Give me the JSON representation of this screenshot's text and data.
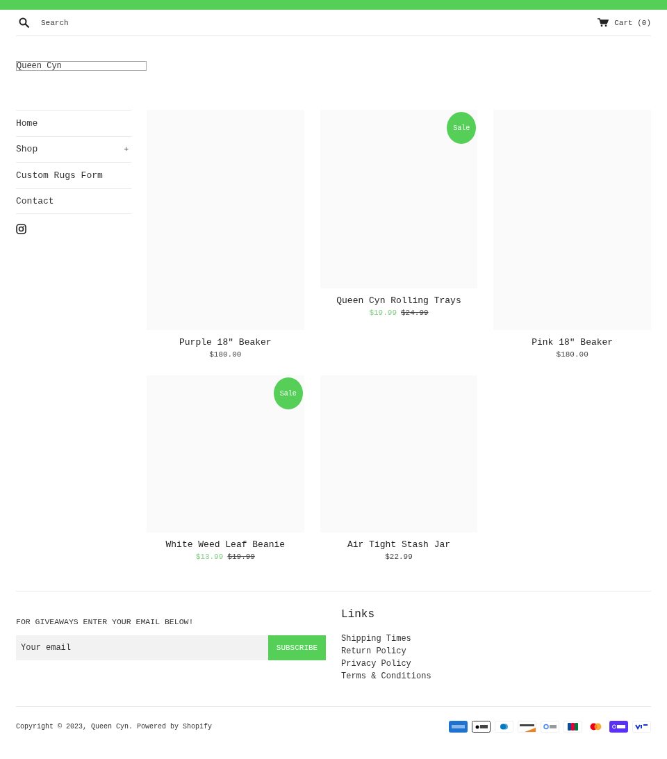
{
  "header": {
    "search_placeholder": "Search",
    "cart": "Cart (0)"
  },
  "logo": "Queen Cyn",
  "nav": [
    {
      "label": "Home"
    },
    {
      "label": "Shop",
      "toggle": "+"
    },
    {
      "label": "Custom Rugs Form"
    },
    {
      "label": "Contact"
    }
  ],
  "products": [
    {
      "title": "Purple 18\" Beaker",
      "price": "$180.00",
      "on_sale": false
    },
    {
      "title": "Queen Cyn Rolling Trays",
      "price": "$19.99",
      "compare_price": "$24.99",
      "on_sale": true,
      "badge": "Sale"
    },
    {
      "title": "Pink 18\" Beaker",
      "price": "$180.00",
      "on_sale": false
    },
    {
      "title": "White Weed Leaf Beanie",
      "price": "$13.99",
      "compare_price": "$19.99",
      "on_sale": true,
      "badge": "Sale"
    },
    {
      "title": "Air Tight Stash Jar",
      "price": "$22.99",
      "on_sale": false
    }
  ],
  "newsletter": {
    "heading": "FOR GIVEAWAYS ENTER YOUR EMAIL BELOW!",
    "placeholder": "Your email",
    "button": "SUBSCRIBE"
  },
  "links": {
    "heading": "Links",
    "items": [
      "Shipping Times",
      "Return Policy",
      "Privacy Policy",
      "Terms & Conditions"
    ]
  },
  "copyright": {
    "prefix": "Copyright © 2023,",
    "store": "Queen Cyn",
    "separator": ".",
    "powered": "Powered by Shopify"
  },
  "payments": [
    {
      "kind": "amex"
    },
    {
      "kind": "apple_pay"
    },
    {
      "kind": "diners"
    },
    {
      "kind": "discover"
    },
    {
      "kind": "google_pay"
    },
    {
      "kind": "jcb"
    },
    {
      "kind": "mastercard"
    },
    {
      "kind": "shop_pay"
    },
    {
      "kind": "visa"
    }
  ]
}
